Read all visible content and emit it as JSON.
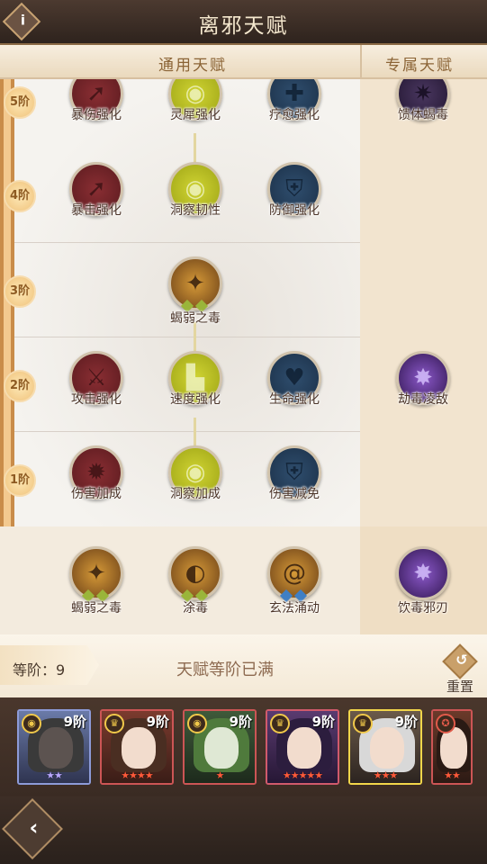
{
  "header": {
    "title": "离邪天赋",
    "info_label": "i"
  },
  "tabs": {
    "general": "通用天赋",
    "exclusive": "专属天赋"
  },
  "tiers": [
    "5阶",
    "4阶",
    "3阶",
    "2阶",
    "1阶"
  ],
  "tree": {
    "tier5": [
      "暴伤强化",
      "灵犀强化",
      "疗愈强化",
      "馈体蝎毒"
    ],
    "tier4": [
      "暴击强化",
      "洞察韧性",
      "防御强化"
    ],
    "tier3": [
      "蝎弱之毒"
    ],
    "tier2": [
      "攻击强化",
      "速度强化",
      "生命强化",
      "劫毒凌敌"
    ],
    "tier1": [
      "伤害加成",
      "洞察加成",
      "伤害减免"
    ]
  },
  "bottom_row": [
    "蝎弱之毒",
    "涂毒",
    "玄法涌动",
    "饮毒邪刃"
  ],
  "level": {
    "label": "等阶：",
    "value": "9",
    "max_text": "天赋等阶已满",
    "reset_label": "重置",
    "reset_icon": "undo-icon"
  },
  "heroes": [
    {
      "level": "9阶",
      "stars": "★★",
      "star_color": "#b8a7ff",
      "border": "b"
    },
    {
      "level": "9阶",
      "stars": "★★★★",
      "star_color": "#ff5a3a",
      "border": "r"
    },
    {
      "level": "9阶",
      "stars": "★",
      "star_color": "#ff5a3a",
      "border": "r"
    },
    {
      "level": "9阶",
      "stars": "★★★★★",
      "star_color": "#ff5a3a",
      "border": "p"
    },
    {
      "level": "9阶",
      "stars": "★★★",
      "star_color": "#ff5a3a",
      "border": "y"
    },
    {
      "level": "",
      "stars": "★★",
      "star_color": "#ff5a3a",
      "border": "r"
    }
  ],
  "footer": {
    "back_icon": "back-arrow-icon",
    "back_glyph": "‹"
  }
}
